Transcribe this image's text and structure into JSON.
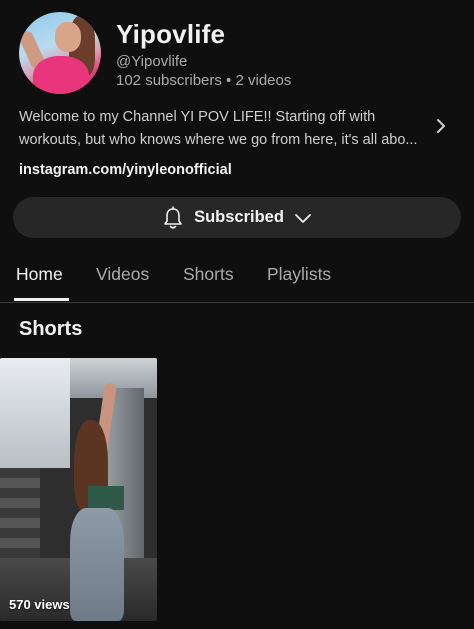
{
  "channel": {
    "name": "Yipovlife",
    "handle": "@Yipovlife",
    "stats": "102 subscribers • 2 videos",
    "description_lines": [
      "Welcome to my Channel YI POV LIFE!! Starting off with",
      "workouts, but who knows where we go from here, it's all abo..."
    ],
    "link": "instagram.com/yinyleonofficial"
  },
  "subscribe_button": {
    "label": "Subscribed"
  },
  "tabs": [
    {
      "label": "Home",
      "active": true
    },
    {
      "label": "Videos",
      "active": false
    },
    {
      "label": "Shorts",
      "active": false
    },
    {
      "label": "Playlists",
      "active": false
    }
  ],
  "shorts_section": {
    "title": "Shorts",
    "items": [
      {
        "views": "570 views"
      }
    ]
  },
  "icons": [
    "bell-icon",
    "chevron-down-icon",
    "chevron-right-icon"
  ],
  "colors": {
    "background": "#0f0f0f",
    "button_bg": "#272727",
    "text": "#f1f1f1",
    "muted": "#aaaaaa"
  }
}
